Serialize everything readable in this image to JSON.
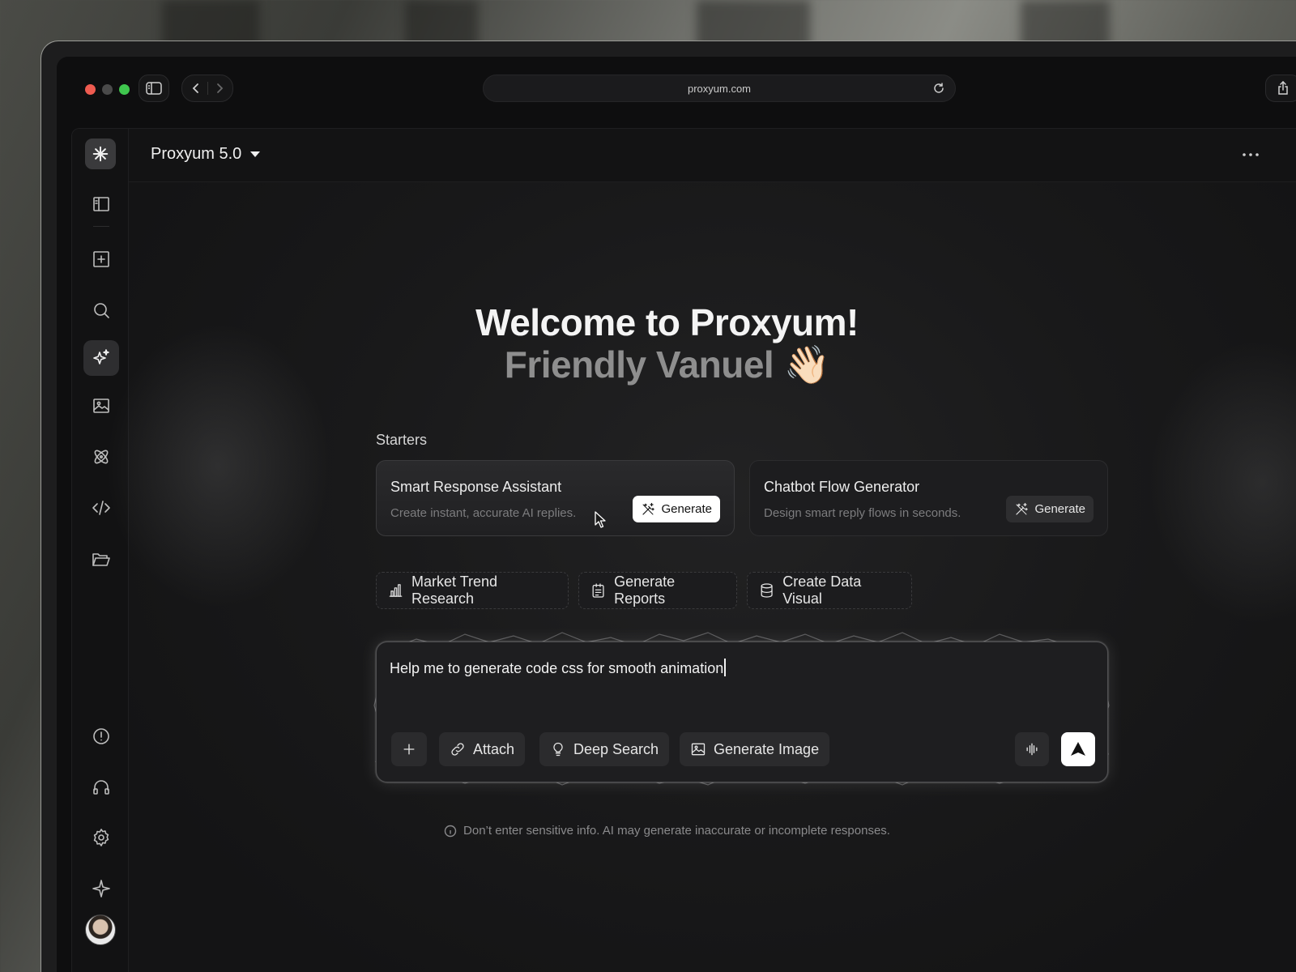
{
  "browser": {
    "url": "proxyum.com",
    "traffic_light_colors": [
      "#ee5b50",
      "#4a4a4a",
      "#3fc64e"
    ]
  },
  "app": {
    "model_name": "Proxyum 5.0",
    "more_icon": "ellipsis-icon",
    "accent": "#ffffff"
  },
  "sidebar": {
    "items": [
      {
        "name": "panel-toggle",
        "icon": "sidebar-icon"
      },
      {
        "name": "new-chat",
        "icon": "plus-square-icon"
      },
      {
        "name": "search",
        "icon": "search-icon"
      },
      {
        "name": "ai-assistant",
        "icon": "sparkles-icon",
        "active": true
      },
      {
        "name": "images",
        "icon": "image-icon"
      },
      {
        "name": "models",
        "icon": "atom-icon"
      },
      {
        "name": "code",
        "icon": "code-icon"
      },
      {
        "name": "files",
        "icon": "folder-icon"
      }
    ],
    "bottom_items": [
      {
        "name": "alerts",
        "icon": "alert-circle-icon"
      },
      {
        "name": "support",
        "icon": "headphones-icon"
      },
      {
        "name": "settings",
        "icon": "gear-icon"
      },
      {
        "name": "upgrade",
        "icon": "star-icon"
      }
    ]
  },
  "welcome": {
    "title": "Welcome to Proxyum!",
    "subtitle": "Friendly Vanuel 👋🏻"
  },
  "starters": {
    "heading": "Starters",
    "cards": [
      {
        "title": "Smart Response Assistant",
        "desc": "Create instant, accurate AI replies.",
        "button": "Generate"
      },
      {
        "title": "Chatbot Flow Generator",
        "desc": "Design smart reply flows in seconds.",
        "button": "Generate"
      }
    ]
  },
  "chips": [
    {
      "label": "Market Trend Research",
      "icon": "bar-chart-icon"
    },
    {
      "label": "Generate Reports",
      "icon": "clipboard-icon"
    },
    {
      "label": "Create Data Visual",
      "icon": "database-icon"
    }
  ],
  "composer": {
    "value": "Help me to generate code css for smooth animation",
    "buttons": {
      "attach": "Attach",
      "deep_search": "Deep Search",
      "generate_image": "Generate Image"
    }
  },
  "disclaimer": "Don’t enter sensitive info. AI may generate inaccurate or incomplete responses."
}
